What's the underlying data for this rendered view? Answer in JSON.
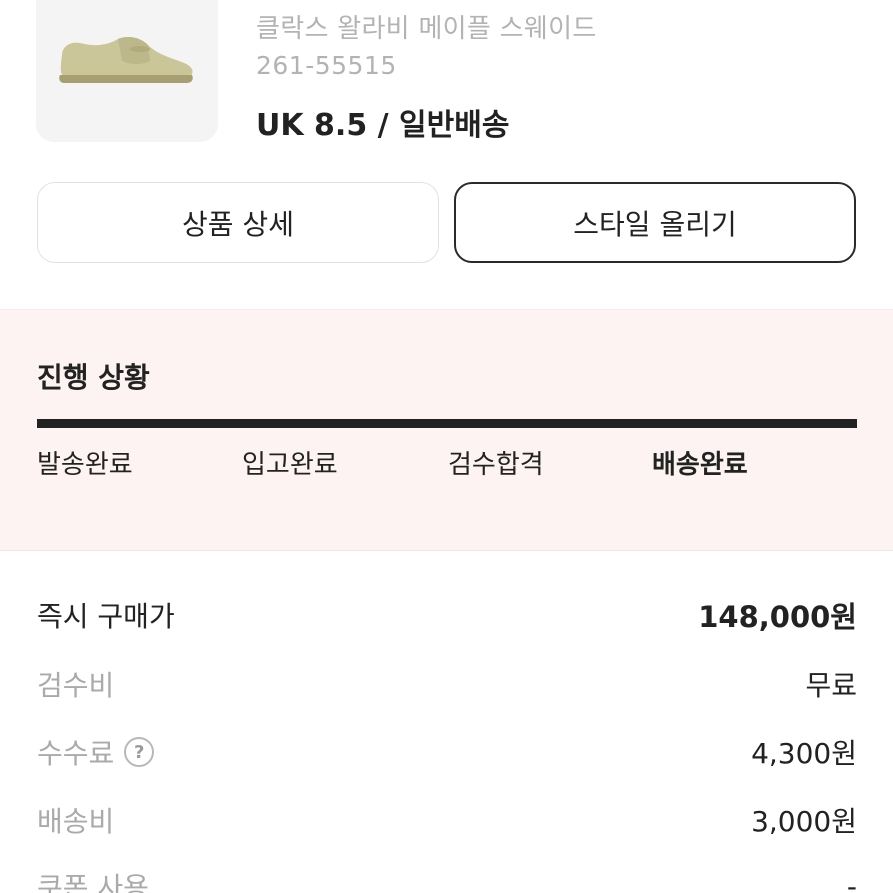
{
  "product": {
    "name": "클락스 왈라비 메이플 스웨이드",
    "code": "261-55515",
    "option": "UK 8.5 / 일반배송",
    "image_icon": "shoe-image"
  },
  "buttons": {
    "detail": "상품 상세",
    "style": "스타일 올리기"
  },
  "progress": {
    "title": "진행 상황",
    "fill_fraction": 1.0,
    "steps": [
      {
        "label": "발송완료",
        "active": false
      },
      {
        "label": "입고완료",
        "active": false
      },
      {
        "label": "검수합격",
        "active": false
      },
      {
        "label": "배송완료",
        "active": true
      }
    ]
  },
  "price": {
    "rows": [
      {
        "label": "즉시 구매가",
        "value": "148,000원"
      },
      {
        "label": "검수비",
        "value": "무료"
      },
      {
        "label": "수수료",
        "value": "4,300원",
        "help_icon": "?"
      },
      {
        "label": "배송비",
        "value": "3,000원"
      },
      {
        "label": "쿠폰 사용",
        "value": "-"
      }
    ]
  },
  "colors": {
    "progress_bg": "#fdf3f2",
    "progress_fill": "#222222",
    "muted_text": "#aaaaaa"
  }
}
